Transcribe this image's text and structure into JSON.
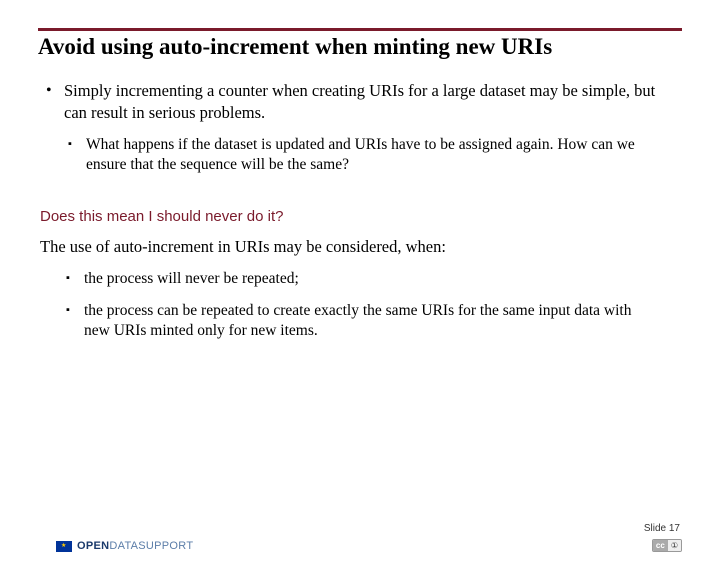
{
  "title": "Avoid using auto-increment when minting new URIs",
  "bullets": {
    "main": "Simply incrementing a counter when creating URIs for a large dataset may be simple, but can result in serious problems.",
    "sub": "What happens if the dataset is updated and URIs have to be assigned again. How can we ensure that the sequence will be the same?"
  },
  "question": "Does this mean I should never do it?",
  "body": "The use of auto-increment in URIs may be considered, when:",
  "conditions": [
    "the process will never be repeated;",
    "the process can be repeated to create exactly the same URIs for the same input data with new URIs minted only for new items."
  ],
  "logo": {
    "open": "OPEN",
    "data": "DATA",
    "support": "SUPPORT"
  },
  "slide_num": "Slide 17",
  "cc": {
    "a": "cc",
    "b": "①"
  }
}
